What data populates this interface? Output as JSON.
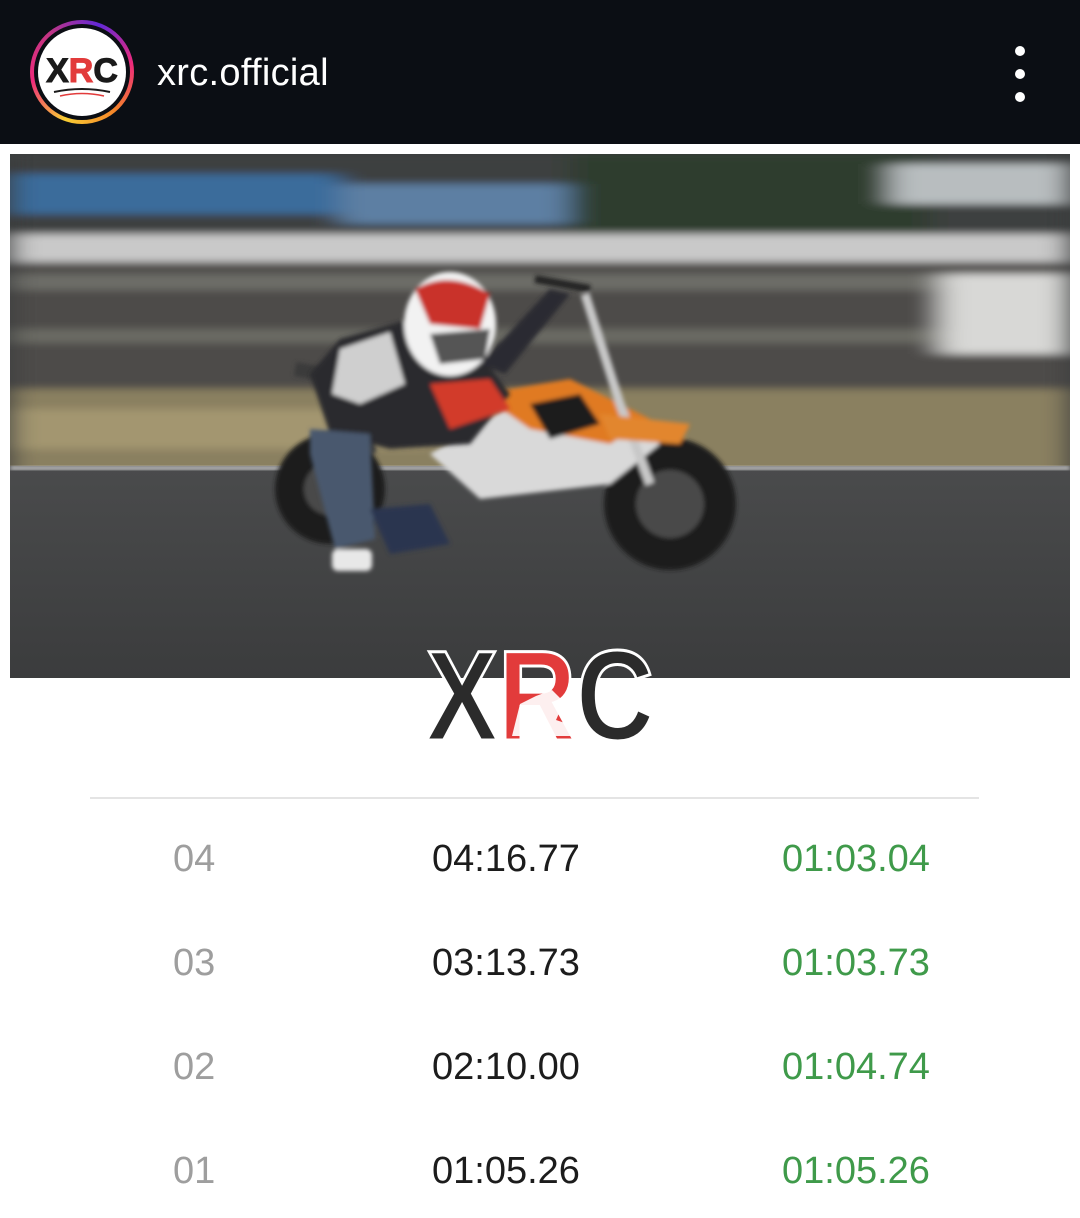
{
  "header": {
    "username": "xrc.official",
    "avatar_logo_text": "XRC",
    "menu_icon": "more-vertical-icon"
  },
  "post": {
    "photo_description_icon": "motorbike-photo",
    "watermark_logo_text": "XRC"
  },
  "laps": [
    {
      "lap": "04",
      "total": "04:16.77",
      "split": "01:03.04"
    },
    {
      "lap": "03",
      "total": "03:13.73",
      "split": "01:03.73"
    },
    {
      "lap": "02",
      "total": "02:10.00",
      "split": "01:04.74"
    },
    {
      "lap": "01",
      "total": "01:05.26",
      "split": "01:05.26"
    }
  ],
  "colors": {
    "header_bg": "#0b0e14",
    "lap_number": "#9e9e9e",
    "lap_total": "#1c1c1c",
    "lap_split": "#3f9a4a",
    "logo_red": "#e23b3b"
  }
}
